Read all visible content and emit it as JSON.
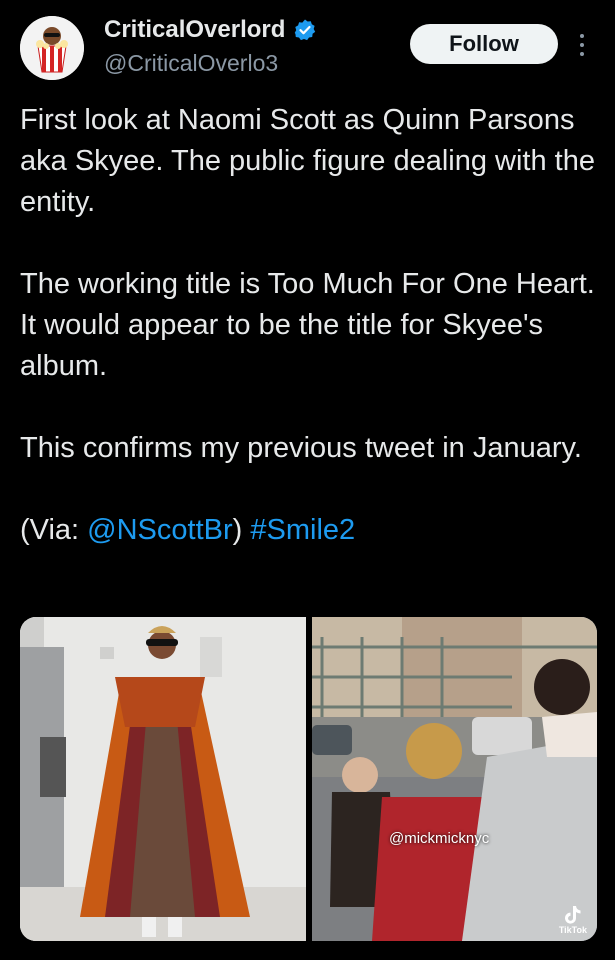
{
  "author": {
    "display_name": "CriticalOverlord",
    "handle": "@CriticalOverlo3",
    "verified": true,
    "verified_color": "#1d9bf0"
  },
  "follow_label": "Follow",
  "tweet": {
    "paragraph1": "First look at Naomi Scott as Quinn Parsons aka Skyee. The public figure dealing with the entity.",
    "paragraph2": "The working title is Too Much For One Heart. It would appear to be the title for Skyee's album.",
    "paragraph3": "This confirms my previous tweet in January.",
    "via_prefix": "(Via: ",
    "via_mention": "@NScottBr",
    "via_suffix": ")",
    "hashtag": "#Smile2",
    "link_color": "#1d9bf0"
  },
  "media": {
    "right_watermark": "@mickmicknyc",
    "tiktok_label": "TikTok"
  }
}
